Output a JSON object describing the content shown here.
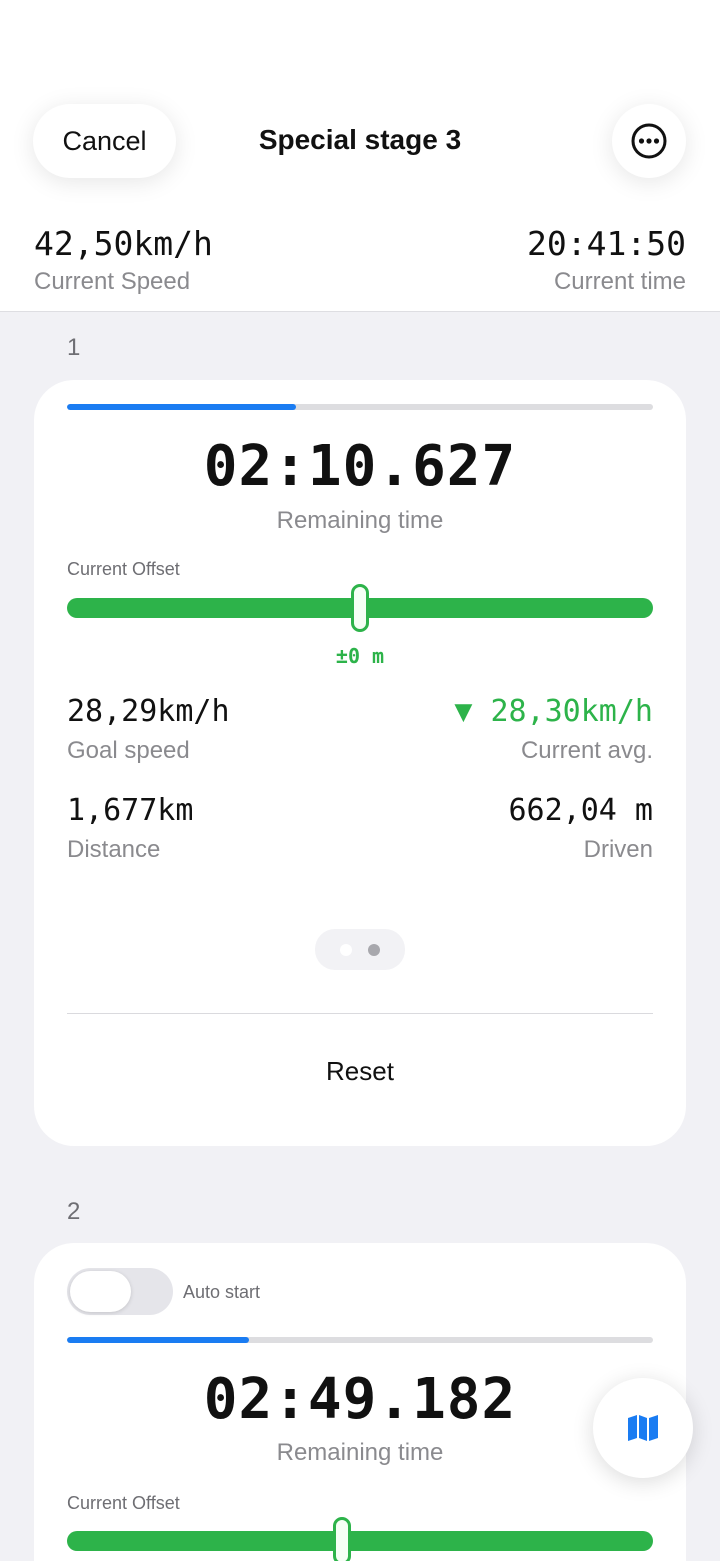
{
  "header": {
    "cancel_label": "Cancel",
    "title": "Special stage 3",
    "more_icon": "ellipsis-circle-icon",
    "current_speed_value": "42,50km/h",
    "current_speed_label": "Current Speed",
    "current_time_value": "20:41:50",
    "current_time_label": "Current time"
  },
  "stages": [
    {
      "number": "1",
      "progress": 0.39,
      "remaining_time": "02:10.627",
      "remaining_label": "Remaining time",
      "offset_label": "Current Offset",
      "offset_position": 0.5,
      "offset_value": "±0 m",
      "goal_speed_value": "28,29km/h",
      "goal_speed_label": "Goal speed",
      "current_avg_indicator": "▼",
      "current_avg_value": "28,30km/h",
      "current_avg_label": "Current avg.",
      "distance_value": "1,677km",
      "distance_label": "Distance",
      "driven_value": "662,04 m",
      "driven_label": "Driven",
      "pager_active_index": 1,
      "reset_label": "Reset"
    },
    {
      "number": "2",
      "auto_start_label": "Auto start",
      "auto_start_on": false,
      "progress": 0.31,
      "remaining_time": "02:49.182",
      "remaining_label": "Remaining time",
      "offset_label": "Current Offset",
      "offset_position": 0.47
    }
  ],
  "map_button_icon": "map-icon",
  "colors": {
    "accent_blue": "#1a7cf2",
    "green": "#2db34a",
    "background": "#f1f1f5"
  }
}
